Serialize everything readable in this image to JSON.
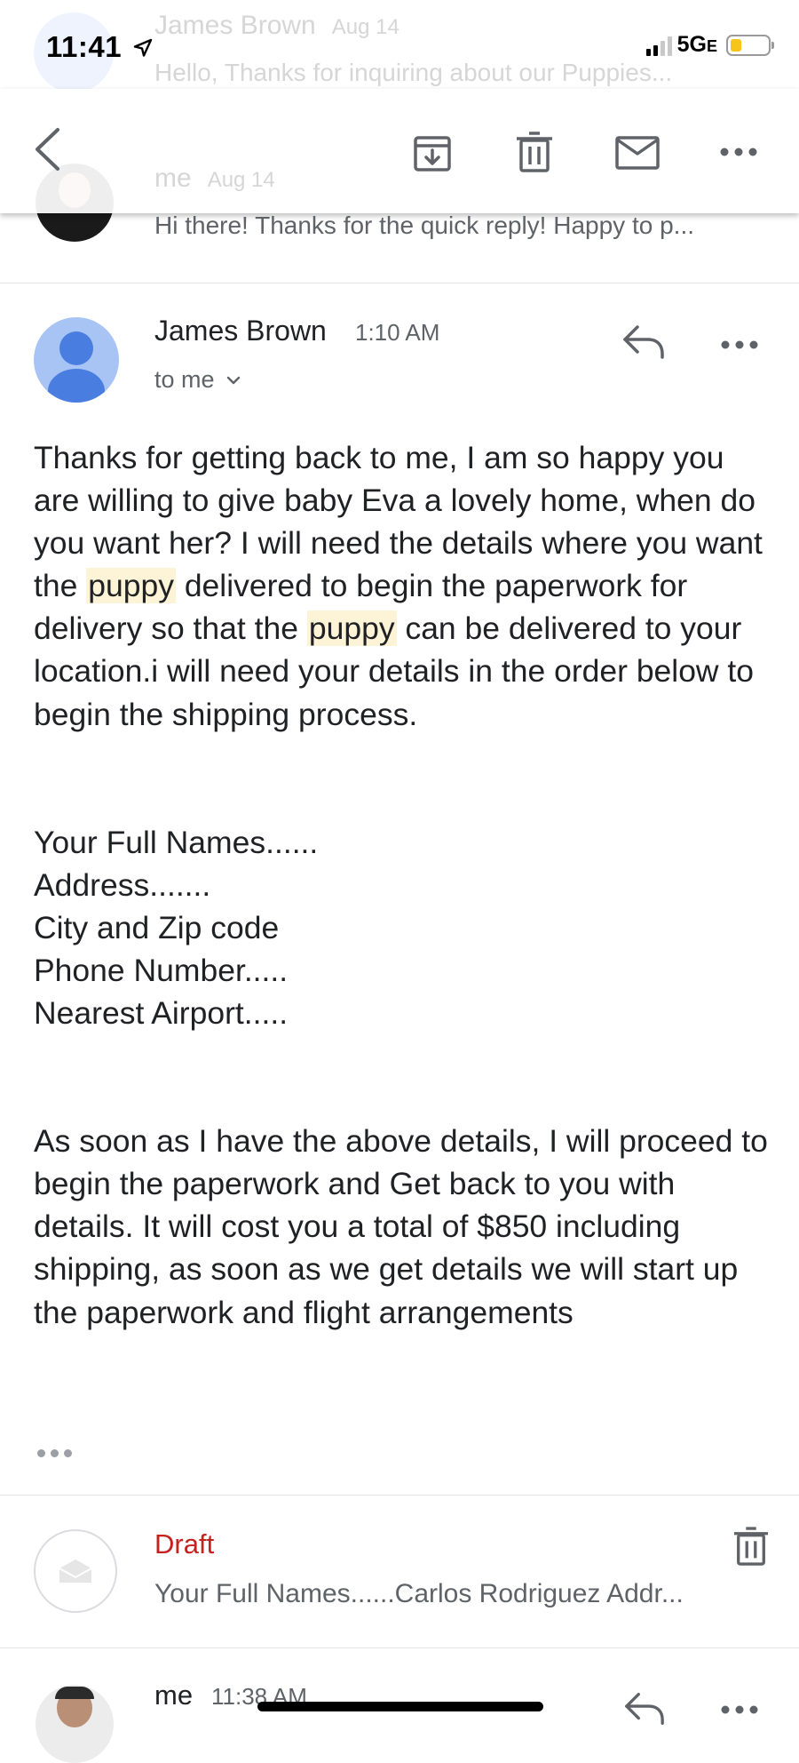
{
  "status_bar": {
    "time": "11:41",
    "network": "5G",
    "network_suffix": "E"
  },
  "ghost_message": {
    "sender": "James Brown",
    "date": "Aug 14",
    "snippet": "Hello, Thanks for inquiring about our Puppies..."
  },
  "ghost_reply": {
    "sender": "me",
    "date": "Aug 14"
  },
  "previous_message": {
    "snippet": "Hi there! Thanks for the quick reply! Happy to p..."
  },
  "toolbar": {
    "icons": [
      "back-arrow-icon",
      "archive-icon",
      "trash-icon",
      "mail-icon",
      "more-icon"
    ]
  },
  "message": {
    "sender": "James Brown",
    "time": "1:10 AM",
    "recipient": "to me",
    "paragraph1": {
      "part1": "Thanks for getting back to me, I am so happy you are willing to give baby Eva a lovely home, when do you want her? I will need the details where you want the ",
      "highlight1": "puppy",
      "part2": " delivered to begin the paperwork for delivery so that the ",
      "highlight2": "puppy",
      "part3": " can be delivered to your location.i will need your details in the order below to begin the shipping process."
    },
    "fields": [
      "Your Full Names......",
      "Address.......",
      "City and Zip code",
      "Phone Number.....",
      "Nearest Airport....."
    ],
    "paragraph2": "As soon as I have the above details, I will proceed to  begin the paperwork and Get back to you with details. It will cost you a total of $850 including shipping, as soon as we get details we will start up the paperwork and flight arrangements"
  },
  "draft": {
    "label": "Draft",
    "snippet": "Your Full Names......Carlos Rodriguez Addr..."
  },
  "reply": {
    "sender": "me",
    "time": "11:38 AM"
  },
  "colors": {
    "draft_red": "#c5221f",
    "highlight": "#fdf3d6",
    "avatar_blue": "#a8c4f4",
    "avatar_blue_dark": "#4a7de0"
  }
}
